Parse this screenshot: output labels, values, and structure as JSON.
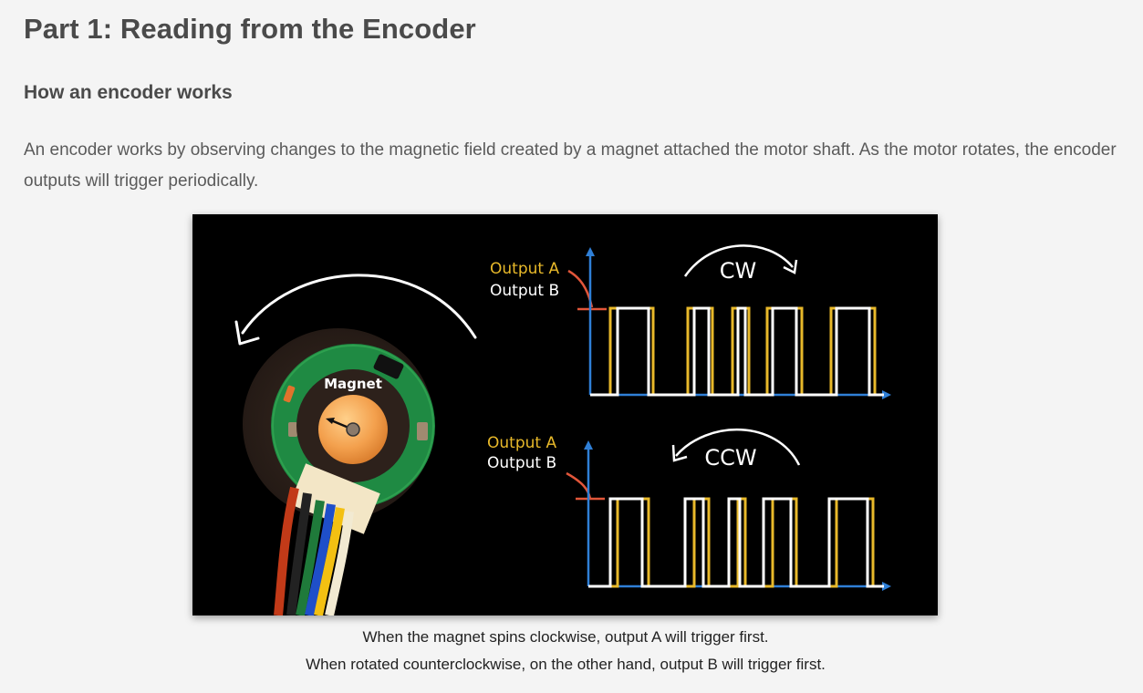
{
  "heading": "Part 1: Reading from the Encoder",
  "subheading": "How an encoder works",
  "paragraph": "An encoder works by observing changes to the magnetic field created by a magnet attached the motor shaft. As the motor rotates, the encoder outputs will trigger periodically.",
  "figure": {
    "magnet_label": "Magnet",
    "top_panel": {
      "label_a": "Output A",
      "label_b": "Output B",
      "direction": "CW"
    },
    "bottom_panel": {
      "label_a": "Output A",
      "label_b": "Output B",
      "direction": "CCW"
    },
    "colors": {
      "output_a": "#e8b92a",
      "output_b": "#ffffff",
      "axis": "#2f7fd6",
      "pointer": "#e2563a"
    }
  },
  "caption": {
    "line1": "When the magnet spins clockwise, output A will trigger first.",
    "line2": "When rotated counterclockwise, on the other hand, output B will trigger first."
  }
}
